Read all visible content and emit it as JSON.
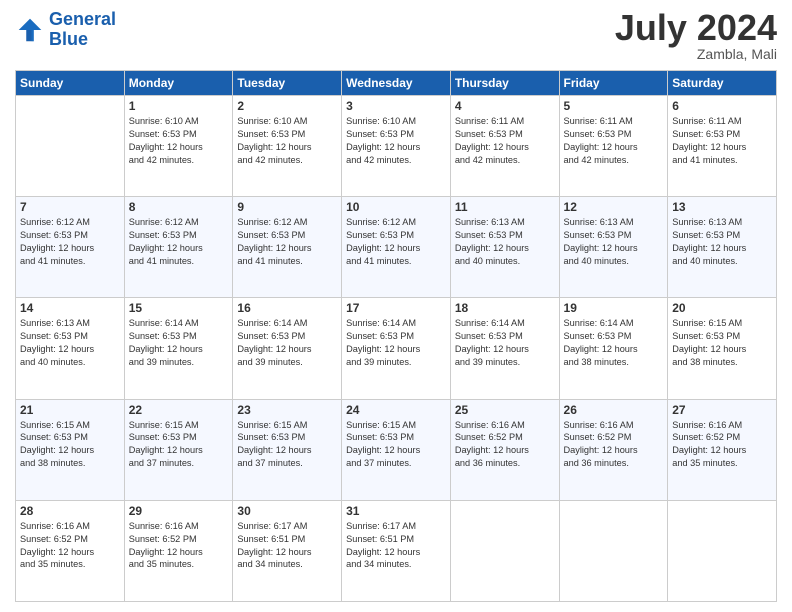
{
  "header": {
    "logo_line1": "General",
    "logo_line2": "Blue",
    "month_year": "July 2024",
    "location": "Zambla, Mali"
  },
  "days_of_week": [
    "Sunday",
    "Monday",
    "Tuesday",
    "Wednesday",
    "Thursday",
    "Friday",
    "Saturday"
  ],
  "weeks": [
    [
      {
        "day": "",
        "info": ""
      },
      {
        "day": "1",
        "info": "Sunrise: 6:10 AM\nSunset: 6:53 PM\nDaylight: 12 hours\nand 42 minutes."
      },
      {
        "day": "2",
        "info": "Sunrise: 6:10 AM\nSunset: 6:53 PM\nDaylight: 12 hours\nand 42 minutes."
      },
      {
        "day": "3",
        "info": "Sunrise: 6:10 AM\nSunset: 6:53 PM\nDaylight: 12 hours\nand 42 minutes."
      },
      {
        "day": "4",
        "info": "Sunrise: 6:11 AM\nSunset: 6:53 PM\nDaylight: 12 hours\nand 42 minutes."
      },
      {
        "day": "5",
        "info": "Sunrise: 6:11 AM\nSunset: 6:53 PM\nDaylight: 12 hours\nand 42 minutes."
      },
      {
        "day": "6",
        "info": "Sunrise: 6:11 AM\nSunset: 6:53 PM\nDaylight: 12 hours\nand 41 minutes."
      }
    ],
    [
      {
        "day": "7",
        "info": "Sunrise: 6:12 AM\nSunset: 6:53 PM\nDaylight: 12 hours\nand 41 minutes."
      },
      {
        "day": "8",
        "info": "Sunrise: 6:12 AM\nSunset: 6:53 PM\nDaylight: 12 hours\nand 41 minutes."
      },
      {
        "day": "9",
        "info": "Sunrise: 6:12 AM\nSunset: 6:53 PM\nDaylight: 12 hours\nand 41 minutes."
      },
      {
        "day": "10",
        "info": "Sunrise: 6:12 AM\nSunset: 6:53 PM\nDaylight: 12 hours\nand 41 minutes."
      },
      {
        "day": "11",
        "info": "Sunrise: 6:13 AM\nSunset: 6:53 PM\nDaylight: 12 hours\nand 40 minutes."
      },
      {
        "day": "12",
        "info": "Sunrise: 6:13 AM\nSunset: 6:53 PM\nDaylight: 12 hours\nand 40 minutes."
      },
      {
        "day": "13",
        "info": "Sunrise: 6:13 AM\nSunset: 6:53 PM\nDaylight: 12 hours\nand 40 minutes."
      }
    ],
    [
      {
        "day": "14",
        "info": "Sunrise: 6:13 AM\nSunset: 6:53 PM\nDaylight: 12 hours\nand 40 minutes."
      },
      {
        "day": "15",
        "info": "Sunrise: 6:14 AM\nSunset: 6:53 PM\nDaylight: 12 hours\nand 39 minutes."
      },
      {
        "day": "16",
        "info": "Sunrise: 6:14 AM\nSunset: 6:53 PM\nDaylight: 12 hours\nand 39 minutes."
      },
      {
        "day": "17",
        "info": "Sunrise: 6:14 AM\nSunset: 6:53 PM\nDaylight: 12 hours\nand 39 minutes."
      },
      {
        "day": "18",
        "info": "Sunrise: 6:14 AM\nSunset: 6:53 PM\nDaylight: 12 hours\nand 39 minutes."
      },
      {
        "day": "19",
        "info": "Sunrise: 6:14 AM\nSunset: 6:53 PM\nDaylight: 12 hours\nand 38 minutes."
      },
      {
        "day": "20",
        "info": "Sunrise: 6:15 AM\nSunset: 6:53 PM\nDaylight: 12 hours\nand 38 minutes."
      }
    ],
    [
      {
        "day": "21",
        "info": "Sunrise: 6:15 AM\nSunset: 6:53 PM\nDaylight: 12 hours\nand 38 minutes."
      },
      {
        "day": "22",
        "info": "Sunrise: 6:15 AM\nSunset: 6:53 PM\nDaylight: 12 hours\nand 37 minutes."
      },
      {
        "day": "23",
        "info": "Sunrise: 6:15 AM\nSunset: 6:53 PM\nDaylight: 12 hours\nand 37 minutes."
      },
      {
        "day": "24",
        "info": "Sunrise: 6:15 AM\nSunset: 6:53 PM\nDaylight: 12 hours\nand 37 minutes."
      },
      {
        "day": "25",
        "info": "Sunrise: 6:16 AM\nSunset: 6:52 PM\nDaylight: 12 hours\nand 36 minutes."
      },
      {
        "day": "26",
        "info": "Sunrise: 6:16 AM\nSunset: 6:52 PM\nDaylight: 12 hours\nand 36 minutes."
      },
      {
        "day": "27",
        "info": "Sunrise: 6:16 AM\nSunset: 6:52 PM\nDaylight: 12 hours\nand 35 minutes."
      }
    ],
    [
      {
        "day": "28",
        "info": "Sunrise: 6:16 AM\nSunset: 6:52 PM\nDaylight: 12 hours\nand 35 minutes."
      },
      {
        "day": "29",
        "info": "Sunrise: 6:16 AM\nSunset: 6:52 PM\nDaylight: 12 hours\nand 35 minutes."
      },
      {
        "day": "30",
        "info": "Sunrise: 6:17 AM\nSunset: 6:51 PM\nDaylight: 12 hours\nand 34 minutes."
      },
      {
        "day": "31",
        "info": "Sunrise: 6:17 AM\nSunset: 6:51 PM\nDaylight: 12 hours\nand 34 minutes."
      },
      {
        "day": "",
        "info": ""
      },
      {
        "day": "",
        "info": ""
      },
      {
        "day": "",
        "info": ""
      }
    ]
  ]
}
